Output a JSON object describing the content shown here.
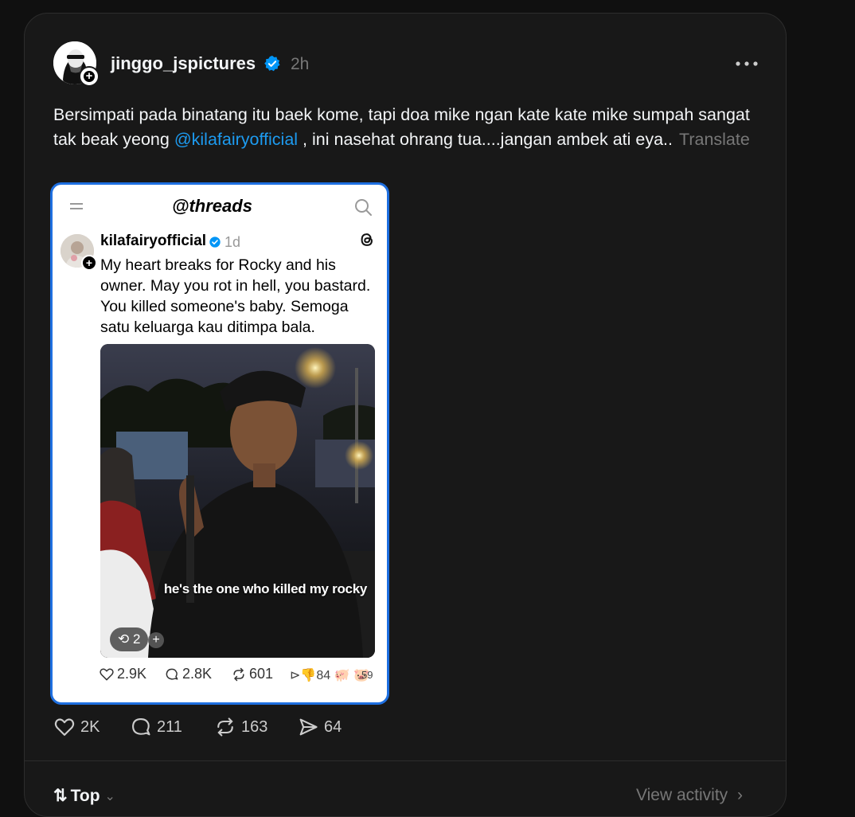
{
  "post": {
    "username": "jinggo_jspictures",
    "time": "2h",
    "text_before": "Bersimpati pada binatang itu baek kome, tapi doa mike ngan kate kate mike sumpah sangat tak beak yeong ",
    "mention": "@kilafairyofficial",
    "text_after": " , ini nasehat ohrang tua....jangan ambek ati eya..",
    "translate": "Translate"
  },
  "screenshot": {
    "logo": "threads",
    "username": "kilafairyofficial",
    "time": "1d",
    "text": "My heart breaks for Rocky and his owner. May you rot in hell, you bastard. You killed someone's baby. Semoga satu keluarga kau ditimpa bala.",
    "caption": "he's the one who killed my rocky",
    "repost_count": "2",
    "likes": "2.9K",
    "replies": "2.8K",
    "reposts": "601",
    "shares": "84",
    "reactions_count": "59"
  },
  "actions": {
    "likes": "2K",
    "replies": "211",
    "reposts": "163",
    "shares": "64"
  },
  "footer": {
    "sort_label": "Top",
    "view_activity": "View activity"
  },
  "colors": {
    "background": "#101010",
    "card": "#181818",
    "accent": "#1d9bf0",
    "verified": "#0095f6"
  }
}
